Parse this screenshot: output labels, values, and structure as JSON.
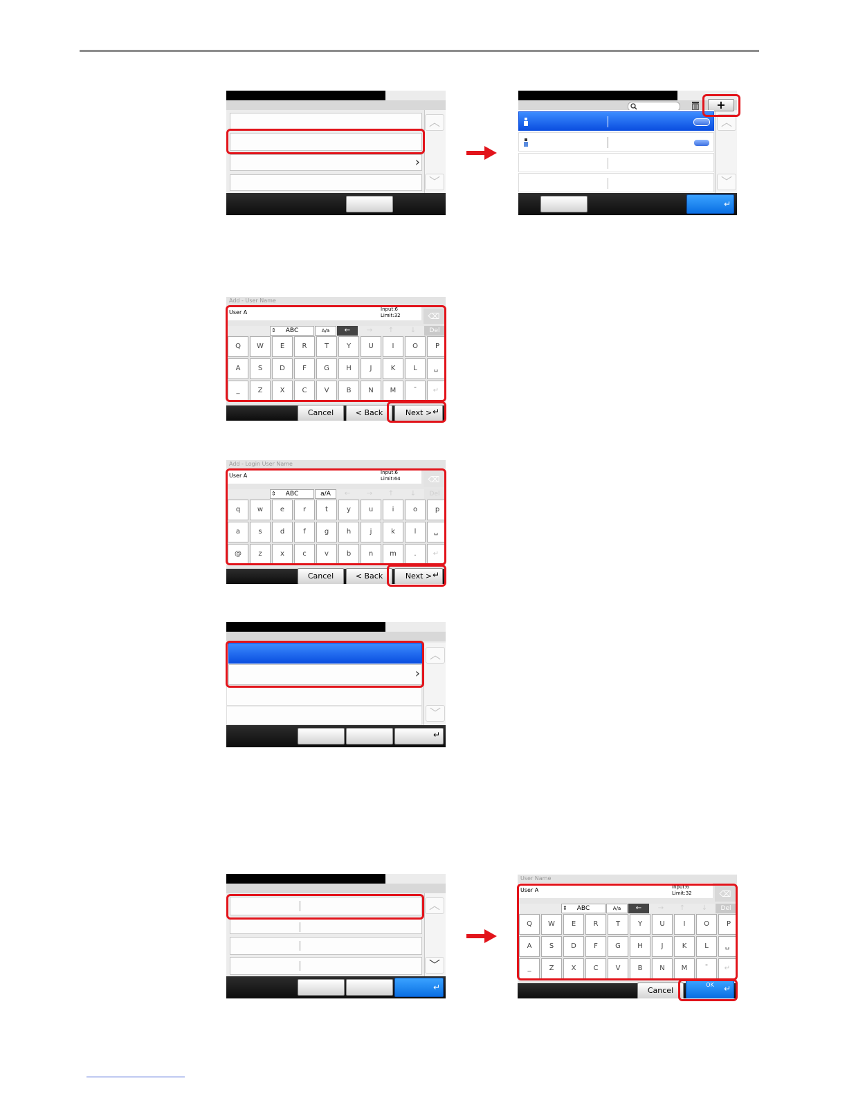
{
  "keyboard_upper": {
    "title": "Add - User Name",
    "value": "User A",
    "input_count": "Input:6",
    "limit": "Limit:32",
    "mode": "ABC",
    "case": "A/a",
    "del": "Del",
    "rows": [
      [
        "Q",
        "W",
        "E",
        "R",
        "T",
        "Y",
        "U",
        "I",
        "O",
        "P"
      ],
      [
        "A",
        "S",
        "D",
        "F",
        "G",
        "H",
        "J",
        "K",
        "L"
      ],
      [
        "_",
        "Z",
        "X",
        "C",
        "V",
        "B",
        "N",
        "M",
        "¯"
      ]
    ],
    "cancel": "Cancel",
    "back": "< Back",
    "next": "Next >"
  },
  "keyboard_lower": {
    "title": "Add - Login User Name",
    "value": "User A",
    "input_count": "Input:6",
    "limit": "Limit:64",
    "mode": "ABC",
    "case": "a/A",
    "del": "Del",
    "rows": [
      [
        "q",
        "w",
        "e",
        "r",
        "t",
        "y",
        "u",
        "i",
        "o",
        "p"
      ],
      [
        "a",
        "s",
        "d",
        "f",
        "g",
        "h",
        "j",
        "k",
        "l"
      ],
      [
        "@",
        "z",
        "x",
        "c",
        "v",
        "b",
        "n",
        "m",
        "."
      ]
    ],
    "cancel": "Cancel",
    "back": "< Back",
    "next": "Next >"
  },
  "keyboard_edit": {
    "title": "User Name",
    "value": "User A",
    "input_count": "Input:6",
    "limit": "Limit:32",
    "mode": "ABC",
    "case": "A/a",
    "del": "Del",
    "rows": [
      [
        "Q",
        "W",
        "E",
        "R",
        "T",
        "Y",
        "U",
        "I",
        "O",
        "P"
      ],
      [
        "A",
        "S",
        "D",
        "F",
        "G",
        "H",
        "J",
        "K",
        "L"
      ],
      [
        "_",
        "Z",
        "X",
        "C",
        "V",
        "B",
        "N",
        "M",
        "¯"
      ]
    ],
    "cancel": "Cancel",
    "ok": "OK"
  },
  "icons": {
    "plus": "+",
    "enter": "↵",
    "chevron_right": "›",
    "chevron_up": "︿",
    "chevron_down": "﹀",
    "backspace": "⌫",
    "left": "←",
    "right": "→",
    "up": "↑",
    "down": "↓",
    "updown": "⇕",
    "space": "␣"
  },
  "colors": {
    "highlight": "#e2141b",
    "selected_row": "#0b4fe0",
    "ok_button": "#0a6fe3"
  }
}
